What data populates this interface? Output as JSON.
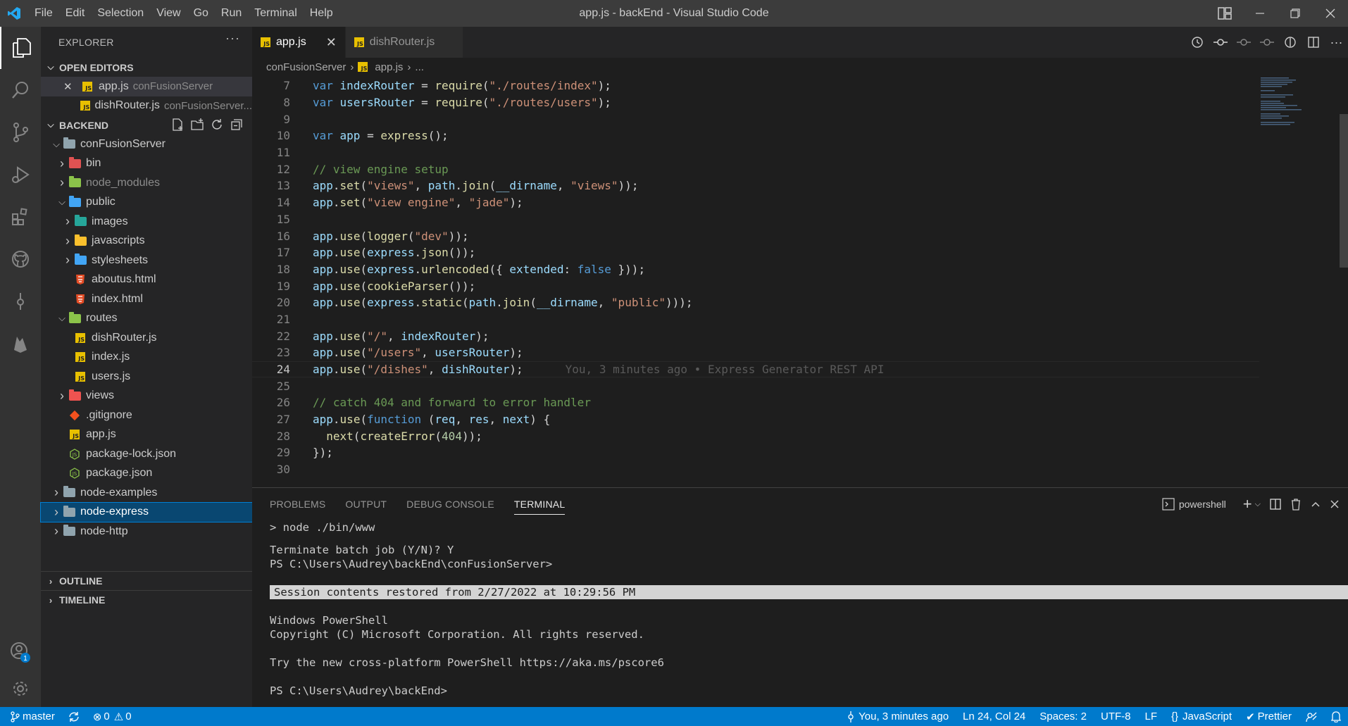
{
  "titlebar": {
    "menu": [
      "File",
      "Edit",
      "Selection",
      "View",
      "Go",
      "Run",
      "Terminal",
      "Help"
    ],
    "title": "app.js - backEnd - Visual Studio Code"
  },
  "sidebar": {
    "header": "EXPLORER",
    "open_editors_label": "OPEN EDITORS",
    "open_editors": [
      {
        "name": "app.js",
        "desc": "conFusionServer"
      },
      {
        "name": "dishRouter.js",
        "desc": "conFusionServer..."
      }
    ],
    "workspace_label": "BACKEND",
    "tree": [
      {
        "name": "conFusionServer",
        "kind": "folder-open",
        "indent": 1
      },
      {
        "name": "bin",
        "kind": "folder",
        "indent": 2,
        "color": "#e05252"
      },
      {
        "name": "node_modules",
        "kind": "folder",
        "indent": 2,
        "color": "#8bc34a",
        "dim": true
      },
      {
        "name": "public",
        "kind": "folder-open",
        "indent": 2,
        "color": "#42a5f5"
      },
      {
        "name": "images",
        "kind": "folder",
        "indent": 3,
        "color": "#26a69a"
      },
      {
        "name": "javascripts",
        "kind": "folder",
        "indent": 3,
        "color": "#fbc02d"
      },
      {
        "name": "stylesheets",
        "kind": "folder",
        "indent": 3,
        "color": "#42a5f5"
      },
      {
        "name": "aboutus.html",
        "kind": "html",
        "indent": 3
      },
      {
        "name": "index.html",
        "kind": "html",
        "indent": 3
      },
      {
        "name": "routes",
        "kind": "folder-open",
        "indent": 2,
        "color": "#8bc34a"
      },
      {
        "name": "dishRouter.js",
        "kind": "js",
        "indent": 3
      },
      {
        "name": "index.js",
        "kind": "js",
        "indent": 3
      },
      {
        "name": "users.js",
        "kind": "js",
        "indent": 3
      },
      {
        "name": "views",
        "kind": "folder",
        "indent": 2,
        "color": "#ef5350"
      },
      {
        "name": ".gitignore",
        "kind": "git",
        "indent": 2
      },
      {
        "name": "app.js",
        "kind": "js",
        "indent": 2
      },
      {
        "name": "package-lock.json",
        "kind": "json",
        "indent": 2
      },
      {
        "name": "package.json",
        "kind": "json",
        "indent": 2
      },
      {
        "name": "node-examples",
        "kind": "folder",
        "indent": 1,
        "color": "#90a4ae"
      },
      {
        "name": "node-express",
        "kind": "folder",
        "indent": 1,
        "color": "#90a4ae",
        "selected": true
      },
      {
        "name": "node-http",
        "kind": "folder",
        "indent": 1,
        "color": "#90a4ae"
      }
    ],
    "outline_label": "OUTLINE",
    "timeline_label": "TIMELINE"
  },
  "editor": {
    "tabs": [
      {
        "name": "app.js",
        "active": true
      },
      {
        "name": "dishRouter.js",
        "active": false
      }
    ],
    "breadcrumb": [
      "conFusionServer",
      "app.js",
      "..."
    ],
    "blame": "You, 3 minutes ago • Express Generator REST API",
    "lines": [
      {
        "n": "7"
      },
      {
        "n": "8"
      },
      {
        "n": "9"
      },
      {
        "n": "10"
      },
      {
        "n": "11"
      },
      {
        "n": "12"
      },
      {
        "n": "13"
      },
      {
        "n": "14"
      },
      {
        "n": "15"
      },
      {
        "n": "16"
      },
      {
        "n": "17"
      },
      {
        "n": "18"
      },
      {
        "n": "19"
      },
      {
        "n": "20"
      },
      {
        "n": "21"
      },
      {
        "n": "22"
      },
      {
        "n": "23"
      },
      {
        "n": "24"
      },
      {
        "n": "25"
      },
      {
        "n": "26"
      },
      {
        "n": "27"
      },
      {
        "n": "28"
      },
      {
        "n": "29"
      },
      {
        "n": "30"
      }
    ]
  },
  "panel": {
    "tabs": [
      "PROBLEMS",
      "OUTPUT",
      "DEBUG CONSOLE",
      "TERMINAL"
    ],
    "active_tab": "TERMINAL",
    "shell": "powershell",
    "terminal": [
      "> node ./bin/www",
      "",
      "Terminate batch job (Y/N)? Y",
      "PS C:\\Users\\Audrey\\backEnd\\conFusionServer>",
      "",
      "Session contents restored from 2/27/2022 at 10:29:56 PM",
      "",
      "Windows PowerShell",
      "Copyright (C) Microsoft Corporation. All rights reserved.",
      "",
      "Try the new cross-platform PowerShell https://aka.ms/pscore6",
      "",
      "PS C:\\Users\\Audrey\\backEnd>"
    ]
  },
  "statusbar": {
    "branch": "master",
    "errors": "0",
    "warnings": "0",
    "blame": "You, 3 minutes ago",
    "position": "Ln 24, Col 24",
    "spaces": "Spaces: 2",
    "encoding": "UTF-8",
    "eol": "LF",
    "language": "JavaScript",
    "formatter": "Prettier"
  },
  "colors": {
    "accent": "#007acc",
    "selection": "#094771"
  }
}
